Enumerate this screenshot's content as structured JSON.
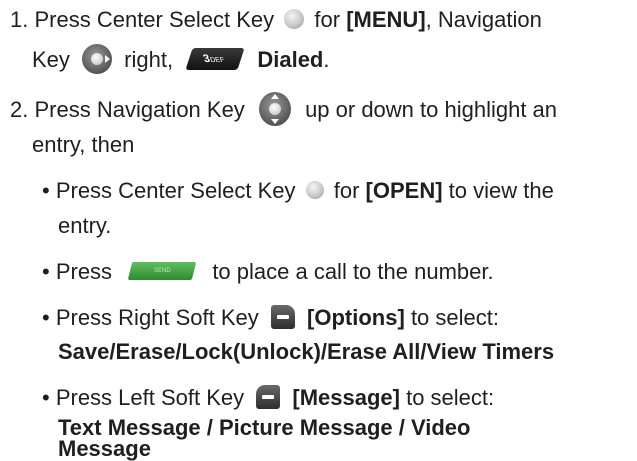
{
  "step1": {
    "number": "1.",
    "text_a": "Press Center Select Key",
    "text_b": "for",
    "menu": "[MENU]",
    "text_c": ", Navigation",
    "text_d": "Key",
    "text_e": "right,",
    "key3_label": "3",
    "key3_sub": "DEF",
    "dialed": "Dialed",
    "period": "."
  },
  "step2": {
    "number": "2.",
    "text_a": "Press Navigation Key",
    "text_b": "up or down to highlight an",
    "text_c": "entry, then"
  },
  "bullets": {
    "b1_a": "• Press Center Select Key",
    "b1_b": "for",
    "b1_open": "[OPEN]",
    "b1_c": "to view the",
    "b1_d": "entry.",
    "b2_a": "• Press",
    "b2_send": "SEND",
    "b2_b": "to place a call to the number.",
    "b3_a": "• Press Right Soft Key",
    "b3_options": "[Options]",
    "b3_b": "to select:",
    "b3_c": "Save/Erase/Lock(Unlock)/Erase All/View Timers",
    "b4_a": "• Press Left Soft Key",
    "b4_message": "[Message]",
    "b4_b": "to select:",
    "b4_c": "Text Message / Picture Message / Video",
    "b4_d": "Message"
  },
  "icons": {
    "center_key": "center-select-key-icon",
    "nav_right": "navigation-key-right-icon",
    "nav_updown": "navigation-key-updown-icon",
    "key3": "number-3-key-icon",
    "send": "send-key-icon",
    "right_soft": "right-soft-key-icon",
    "left_soft": "left-soft-key-icon"
  },
  "colors": {
    "text": "#1f1f1f",
    "send_key": "#3a9a3a"
  }
}
